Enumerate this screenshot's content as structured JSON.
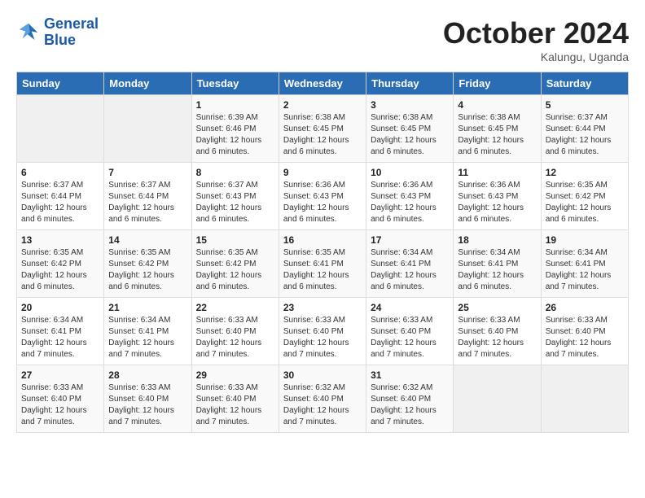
{
  "header": {
    "logo_line1": "General",
    "logo_line2": "Blue",
    "month": "October 2024",
    "location": "Kalungu, Uganda"
  },
  "weekdays": [
    "Sunday",
    "Monday",
    "Tuesday",
    "Wednesday",
    "Thursday",
    "Friday",
    "Saturday"
  ],
  "weeks": [
    [
      {
        "num": "",
        "info": ""
      },
      {
        "num": "",
        "info": ""
      },
      {
        "num": "1",
        "info": "Sunrise: 6:39 AM\nSunset: 6:46 PM\nDaylight: 12 hours and 6 minutes."
      },
      {
        "num": "2",
        "info": "Sunrise: 6:38 AM\nSunset: 6:45 PM\nDaylight: 12 hours and 6 minutes."
      },
      {
        "num": "3",
        "info": "Sunrise: 6:38 AM\nSunset: 6:45 PM\nDaylight: 12 hours and 6 minutes."
      },
      {
        "num": "4",
        "info": "Sunrise: 6:38 AM\nSunset: 6:45 PM\nDaylight: 12 hours and 6 minutes."
      },
      {
        "num": "5",
        "info": "Sunrise: 6:37 AM\nSunset: 6:44 PM\nDaylight: 12 hours and 6 minutes."
      }
    ],
    [
      {
        "num": "6",
        "info": "Sunrise: 6:37 AM\nSunset: 6:44 PM\nDaylight: 12 hours and 6 minutes."
      },
      {
        "num": "7",
        "info": "Sunrise: 6:37 AM\nSunset: 6:44 PM\nDaylight: 12 hours and 6 minutes."
      },
      {
        "num": "8",
        "info": "Sunrise: 6:37 AM\nSunset: 6:43 PM\nDaylight: 12 hours and 6 minutes."
      },
      {
        "num": "9",
        "info": "Sunrise: 6:36 AM\nSunset: 6:43 PM\nDaylight: 12 hours and 6 minutes."
      },
      {
        "num": "10",
        "info": "Sunrise: 6:36 AM\nSunset: 6:43 PM\nDaylight: 12 hours and 6 minutes."
      },
      {
        "num": "11",
        "info": "Sunrise: 6:36 AM\nSunset: 6:43 PM\nDaylight: 12 hours and 6 minutes."
      },
      {
        "num": "12",
        "info": "Sunrise: 6:35 AM\nSunset: 6:42 PM\nDaylight: 12 hours and 6 minutes."
      }
    ],
    [
      {
        "num": "13",
        "info": "Sunrise: 6:35 AM\nSunset: 6:42 PM\nDaylight: 12 hours and 6 minutes."
      },
      {
        "num": "14",
        "info": "Sunrise: 6:35 AM\nSunset: 6:42 PM\nDaylight: 12 hours and 6 minutes."
      },
      {
        "num": "15",
        "info": "Sunrise: 6:35 AM\nSunset: 6:42 PM\nDaylight: 12 hours and 6 minutes."
      },
      {
        "num": "16",
        "info": "Sunrise: 6:35 AM\nSunset: 6:41 PM\nDaylight: 12 hours and 6 minutes."
      },
      {
        "num": "17",
        "info": "Sunrise: 6:34 AM\nSunset: 6:41 PM\nDaylight: 12 hours and 6 minutes."
      },
      {
        "num": "18",
        "info": "Sunrise: 6:34 AM\nSunset: 6:41 PM\nDaylight: 12 hours and 6 minutes."
      },
      {
        "num": "19",
        "info": "Sunrise: 6:34 AM\nSunset: 6:41 PM\nDaylight: 12 hours and 7 minutes."
      }
    ],
    [
      {
        "num": "20",
        "info": "Sunrise: 6:34 AM\nSunset: 6:41 PM\nDaylight: 12 hours and 7 minutes."
      },
      {
        "num": "21",
        "info": "Sunrise: 6:34 AM\nSunset: 6:41 PM\nDaylight: 12 hours and 7 minutes."
      },
      {
        "num": "22",
        "info": "Sunrise: 6:33 AM\nSunset: 6:40 PM\nDaylight: 12 hours and 7 minutes."
      },
      {
        "num": "23",
        "info": "Sunrise: 6:33 AM\nSunset: 6:40 PM\nDaylight: 12 hours and 7 minutes."
      },
      {
        "num": "24",
        "info": "Sunrise: 6:33 AM\nSunset: 6:40 PM\nDaylight: 12 hours and 7 minutes."
      },
      {
        "num": "25",
        "info": "Sunrise: 6:33 AM\nSunset: 6:40 PM\nDaylight: 12 hours and 7 minutes."
      },
      {
        "num": "26",
        "info": "Sunrise: 6:33 AM\nSunset: 6:40 PM\nDaylight: 12 hours and 7 minutes."
      }
    ],
    [
      {
        "num": "27",
        "info": "Sunrise: 6:33 AM\nSunset: 6:40 PM\nDaylight: 12 hours and 7 minutes."
      },
      {
        "num": "28",
        "info": "Sunrise: 6:33 AM\nSunset: 6:40 PM\nDaylight: 12 hours and 7 minutes."
      },
      {
        "num": "29",
        "info": "Sunrise: 6:33 AM\nSunset: 6:40 PM\nDaylight: 12 hours and 7 minutes."
      },
      {
        "num": "30",
        "info": "Sunrise: 6:32 AM\nSunset: 6:40 PM\nDaylight: 12 hours and 7 minutes."
      },
      {
        "num": "31",
        "info": "Sunrise: 6:32 AM\nSunset: 6:40 PM\nDaylight: 12 hours and 7 minutes."
      },
      {
        "num": "",
        "info": ""
      },
      {
        "num": "",
        "info": ""
      }
    ]
  ]
}
